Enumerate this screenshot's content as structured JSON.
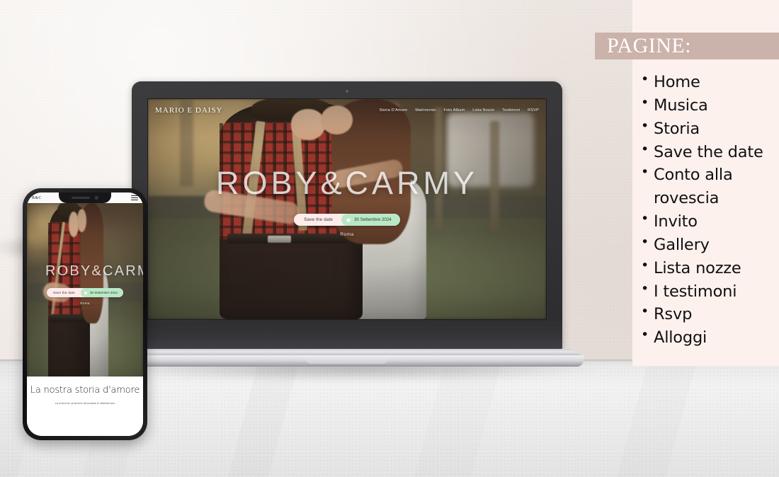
{
  "sidebar": {
    "heading": "PAGINE:",
    "items": [
      "Home",
      "Musica",
      "Storia",
      "Save the date",
      "Conto alla rovescia",
      "Invito",
      "Gallery",
      "Lista nozze",
      "I testimoni",
      "Rsvp",
      "Alloggi"
    ],
    "banner_color": "#cbb2aa",
    "panel_color": "#fdf1ee"
  },
  "laptop": {
    "site": {
      "brand": "MARIO E DAISY",
      "nav": [
        "Storia D'Amore",
        "Matrimonio",
        "Foto Album",
        "Lista Nozze",
        "Testimoni",
        "RSVP"
      ],
      "hero_title": "ROBY&CARMY",
      "save_the_date_label": "Save the date",
      "wedding_date": "30 Settembre 2024",
      "location": "Roma",
      "pill_left_color": "#fdeceb",
      "pill_right_color": "#b9e8c6"
    }
  },
  "phone": {
    "brand": "R&C",
    "hero_title": "ROBY&CARM",
    "save_the_date_label": "Save the date",
    "wedding_date": "30 Settembre 2024",
    "location": "Roma",
    "section_title": "La nostra storia d'amore",
    "section_subtitle": "La storia di un'amore sbocciata in Matrimonio"
  }
}
